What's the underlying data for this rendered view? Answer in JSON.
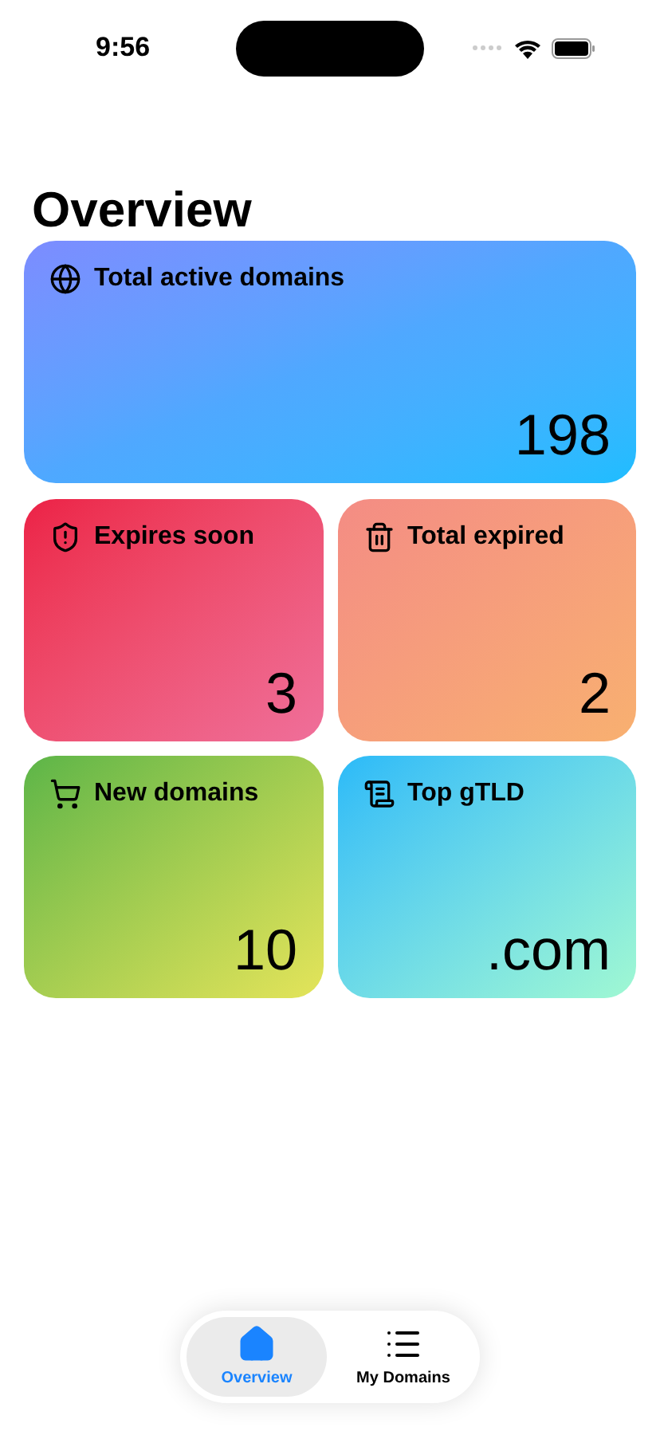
{
  "status_bar": {
    "time": "9:56"
  },
  "title": "Overview",
  "cards": [
    {
      "kind": "globe",
      "label": "Total active domains",
      "value": "198"
    },
    {
      "kind": "shield",
      "label": "Expires soon",
      "value": "3"
    },
    {
      "kind": "trash",
      "label": "Total expired",
      "value": "2"
    },
    {
      "kind": "cart",
      "label": "New domains",
      "value": "10"
    },
    {
      "kind": "scroll",
      "label": "Top gTLD",
      "value": ".com"
    }
  ],
  "tabs": [
    {
      "kind": "home",
      "label": "Overview",
      "selected": true
    },
    {
      "kind": "list",
      "label": "My Domains",
      "selected": false
    }
  ]
}
